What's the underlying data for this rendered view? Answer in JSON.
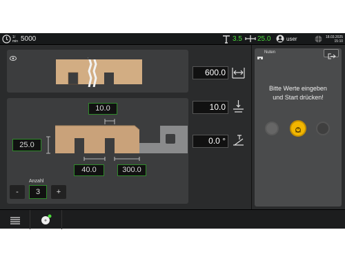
{
  "topbar": {
    "speed_unit_top": "1/",
    "speed_unit_bottom": "min",
    "speed_value": "5000",
    "axis1_value": "3.5",
    "axis2_value": "25.0",
    "user_label": "user",
    "date": "18.03.2025",
    "time": "15:10"
  },
  "diagram": {
    "top_width": "10.0",
    "left_height": "25.0",
    "bottom_spacing": "40.0",
    "bottom_offset": "300.0"
  },
  "quantity": {
    "label": "Anzahl",
    "value": "3",
    "minus": "-",
    "plus": "+"
  },
  "values": {
    "length": "600.0",
    "depth": "10.0",
    "angle": "0.0 °"
  },
  "info_panel": {
    "title": "Nuten",
    "message_line1": "Bitte Werte eingeben",
    "message_line2": "und Start drücken!",
    "start_label": "Start"
  },
  "colors": {
    "accent_green": "#4cdc3c",
    "start_yellow": "#f2b600",
    "wood": "#c9a27a"
  }
}
